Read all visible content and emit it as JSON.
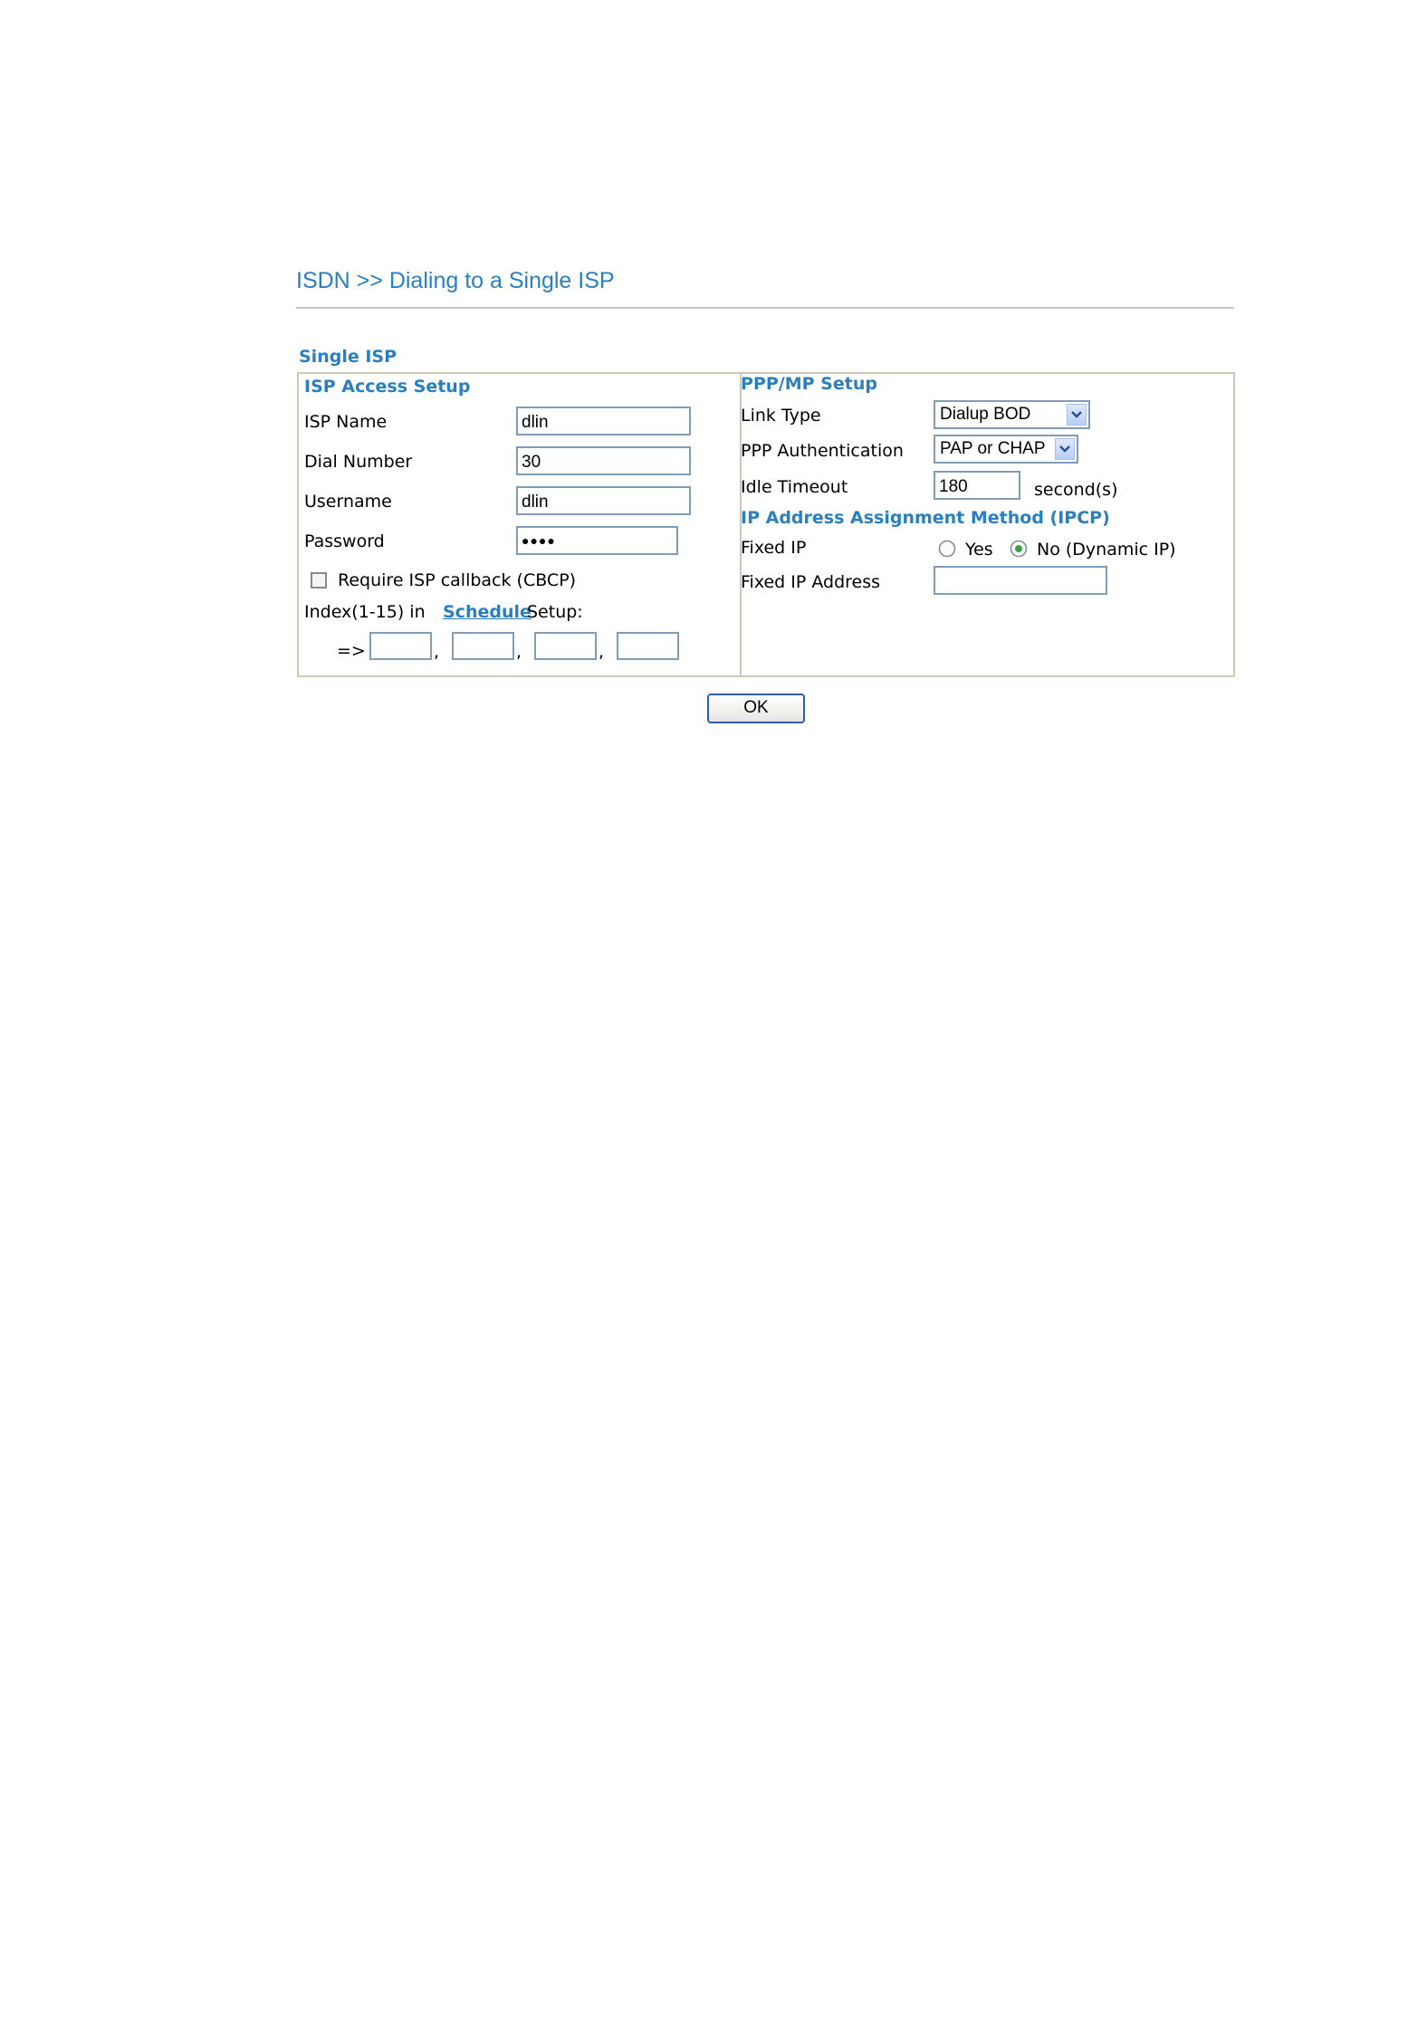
{
  "header": {
    "title": "ISDN >> Dialing to a Single ISP"
  },
  "section": {
    "title": "Single ISP"
  },
  "isp_access": {
    "heading": "ISP Access Setup",
    "isp_name_label": "ISP Name",
    "isp_name_value": "dlin",
    "dial_number_label": "Dial Number",
    "dial_number_value": "30",
    "username_label": "Username",
    "username_value": "dlin",
    "password_label": "Password",
    "password_value": "●●●●",
    "callback_label": "Require ISP callback (CBCP)",
    "callback_checked": false,
    "index_prefix": "Index(1-15) in",
    "schedule_link": "Schedule",
    "index_suffix": "Setup:",
    "arrow": "=>",
    "comma": ",",
    "schedule_indexes": [
      "",
      "",
      "",
      ""
    ]
  },
  "ppp_mp": {
    "heading": "PPP/MP Setup",
    "link_type_label": "Link Type",
    "link_type_value": "Dialup BOD",
    "ppp_auth_label": "PPP Authentication",
    "ppp_auth_value": "PAP or CHAP",
    "idle_timeout_label": "Idle Timeout",
    "idle_timeout_value": "180",
    "idle_timeout_unit": "second(s)"
  },
  "ip_assignment": {
    "heading": "IP Address Assignment Method (IPCP)",
    "fixed_ip_label": "Fixed IP",
    "yes_label": "Yes",
    "no_label": "No (Dynamic IP)",
    "selected": "no",
    "fixed_ip_address_label": "Fixed IP Address",
    "fixed_ip_address_value": ""
  },
  "actions": {
    "ok_label": "OK"
  },
  "colors": {
    "accent": "#2a7fc1",
    "box_border": "#cfc8b5",
    "input_border": "#7f9db9"
  }
}
